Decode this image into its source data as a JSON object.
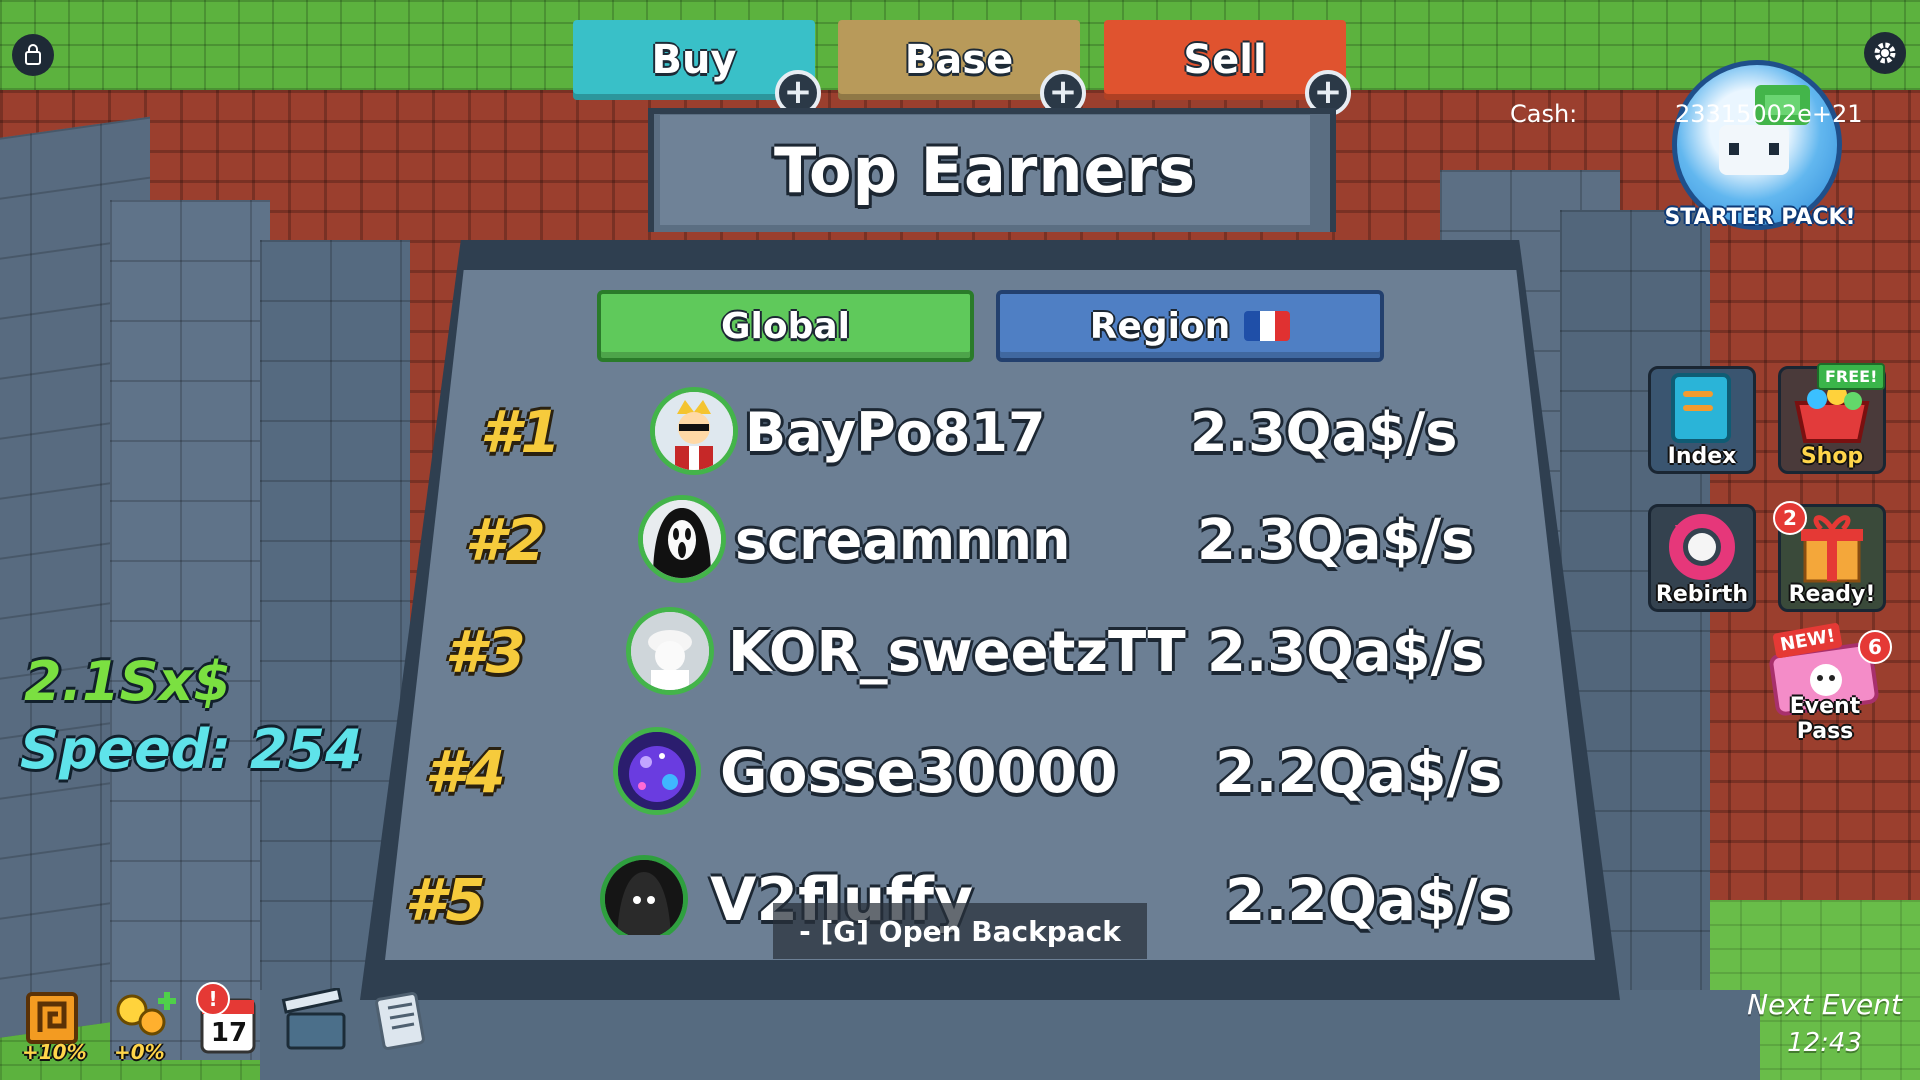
{
  "top_tabs": [
    {
      "label": "Buy",
      "color": "#39c0c8"
    },
    {
      "label": "Base",
      "color": "#b89a5a"
    },
    {
      "label": "Sell",
      "color": "#e0532f"
    }
  ],
  "leaderboard": {
    "title": "Top Earners",
    "tabs": {
      "global": "Global",
      "region": "Region"
    },
    "region_flag": [
      "#1f4fa8",
      "#ffffff",
      "#e03131"
    ],
    "entries": [
      {
        "rank": "#1",
        "name": "BayPo817",
        "rate": "2.3Qa$/s"
      },
      {
        "rank": "#2",
        "name": "screamnnn",
        "rate": "2.3Qa$/s"
      },
      {
        "rank": "#3",
        "name": "KOR_sweetzTT",
        "rate": "2.3Qa$/s"
      },
      {
        "rank": "#4",
        "name": "Gosse30000",
        "rate": "2.2Qa$/s"
      },
      {
        "rank": "#5",
        "name": "V2fluffy",
        "rate": "2.2Qa$/s"
      }
    ]
  },
  "cash": {
    "label": "Cash:",
    "value": "23315002e+21"
  },
  "starter_pack": {
    "label": "STARTER PACK!"
  },
  "side_menu": {
    "index": {
      "label": "Index"
    },
    "shop": {
      "label": "Shop",
      "tag": "FREE!"
    },
    "rebirth": {
      "label": "Rebirth"
    },
    "ready": {
      "label": "Ready!",
      "count": "2"
    },
    "event_pass": {
      "label": "Event Pass",
      "tag": "NEW!",
      "count": "6"
    }
  },
  "stats": {
    "money": "2.1Sx$",
    "speed": "Speed: 254"
  },
  "backpack_hint": "- [G] Open Backpack",
  "hotbar": {
    "boost1": "+10%",
    "boost2": "+0%",
    "calendar_day": "17",
    "alert": "!"
  },
  "next_event": {
    "label": "Next Event",
    "time": "12:43"
  }
}
